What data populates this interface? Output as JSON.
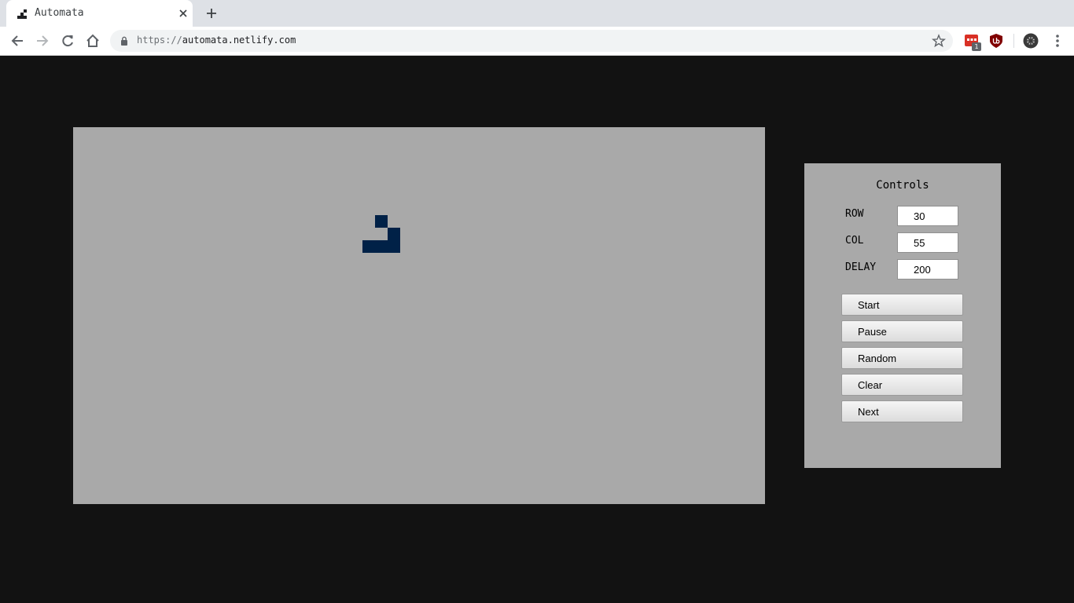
{
  "browser": {
    "tab": {
      "title": "Automata"
    },
    "address_bar": {
      "scheme": "https://",
      "host": "automata.netlify.com"
    },
    "extensions": {
      "badge_count": "1"
    }
  },
  "board": {
    "live_color": "#002147",
    "background_color": "#a9a9a9",
    "live_cells": [
      {
        "row": 7,
        "col": 24
      },
      {
        "row": 8,
        "col": 25
      },
      {
        "row": 9,
        "col": 23
      },
      {
        "row": 9,
        "col": 24
      },
      {
        "row": 9,
        "col": 25
      }
    ]
  },
  "controls": {
    "title": "Controls",
    "fields": {
      "row": {
        "label": "ROW",
        "value": "30"
      },
      "col": {
        "label": "COL",
        "value": "55"
      },
      "delay": {
        "label": "DELAY",
        "value": "200"
      }
    },
    "buttons": {
      "start": "Start",
      "pause": "Pause",
      "random": "Random",
      "clear": "Clear",
      "next": "Next"
    }
  }
}
